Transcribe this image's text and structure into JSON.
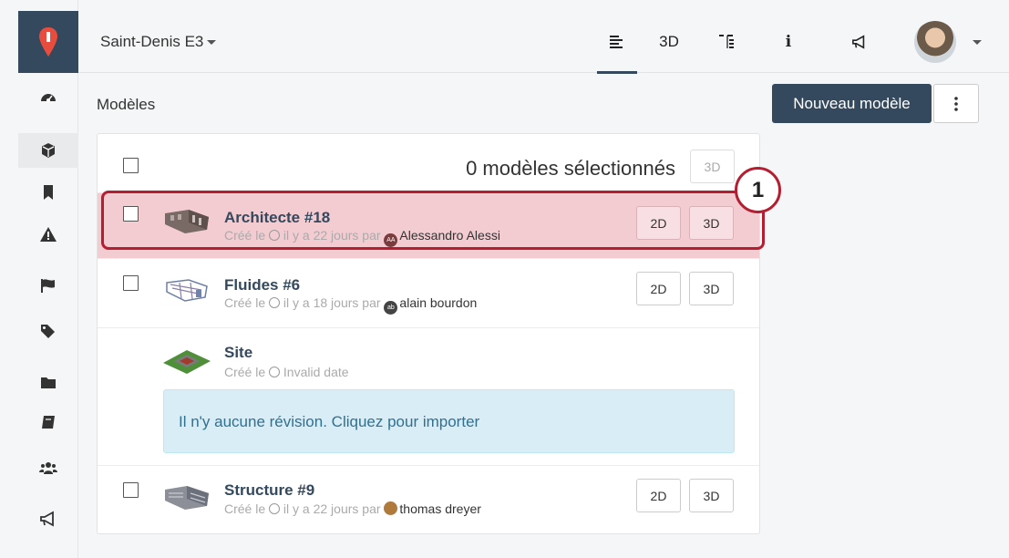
{
  "header": {
    "project_name": "Saint-Denis E3",
    "nav": [
      {
        "icon": "list-icon",
        "label": ""
      },
      {
        "icon": "",
        "label": "3D"
      },
      {
        "icon": "tree-icon",
        "label": ""
      },
      {
        "icon": "info-icon",
        "label": "i"
      },
      {
        "icon": "megaphone-icon",
        "label": ""
      }
    ]
  },
  "sidebar": {
    "items": [
      "dashboard-icon",
      "cube-icon",
      "bookmark-icon",
      "warning-icon",
      "flag-icon",
      "tags-icon",
      "folder-icon",
      "book-icon",
      "users-icon",
      "megaphone-icon"
    ]
  },
  "page": {
    "title": "Modèles",
    "new_button": "Nouveau modèle",
    "more_button": "⋮"
  },
  "list": {
    "selection_text": "0 modèles sélectionnés",
    "header_3d": "3D",
    "models": [
      {
        "name": "Architecte #18",
        "created_prefix": "Créé le",
        "created_when": "il y a 22 jours par",
        "avatar_initials": "AA",
        "user": "Alessandro Alessi",
        "btn_2d": "2D",
        "btn_3d": "3D"
      },
      {
        "name": "Fluides #6",
        "created_prefix": "Créé le",
        "created_when": "il y a 18 jours par",
        "avatar_initials": "ab",
        "user": "alain bourdon",
        "btn_2d": "2D",
        "btn_3d": "3D"
      },
      {
        "name": "Site",
        "created_prefix": "Créé le",
        "created_when": "Invalid date",
        "info": "Il n'y aucune révision. Cliquez pour importer"
      },
      {
        "name": "Structure #9",
        "created_prefix": "Créé le",
        "created_when": "il y a 22 jours par",
        "avatar_initials": "",
        "user": "thomas dreyer",
        "btn_2d": "2D",
        "btn_3d": "3D"
      }
    ]
  },
  "annotation": {
    "label": "1"
  },
  "colors": {
    "primary": "#34495e",
    "highlight": "#f3ccd2",
    "annotation": "#b41e31",
    "info_bg": "#d9edf7"
  }
}
